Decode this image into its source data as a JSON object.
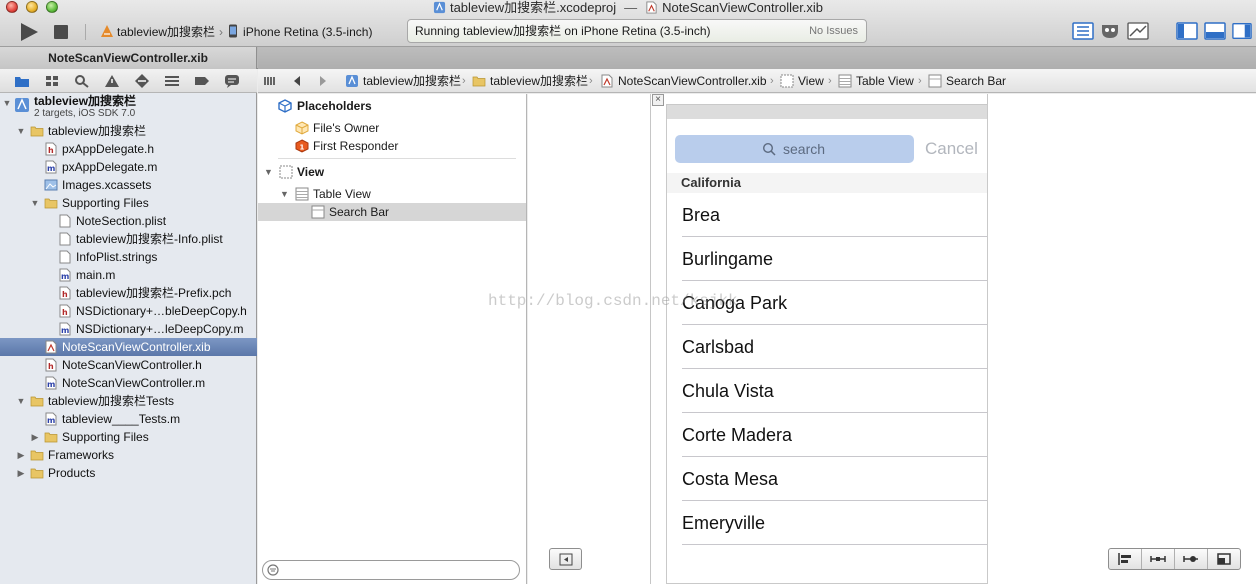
{
  "window": {
    "project_file": "tableview加搜索栏.xcodeproj",
    "separator": "—",
    "open_file": "NoteScanViewController.xib"
  },
  "toolbar": {
    "scheme": "tableview加搜索栏",
    "destination": "iPhone Retina (3.5-inch)",
    "activity_text": "Running tableview加搜索栏 on iPhone Retina (3.5-inch)",
    "activity_status": "No Issues"
  },
  "tab": {
    "title": "NoteScanViewController.xib"
  },
  "project": {
    "name": "tableview加搜索栏",
    "subtitle": "2 targets, iOS SDK 7.0"
  },
  "nav_items": {
    "group_main": "tableview加搜索栏",
    "app_delegate_h": "pxAppDelegate.h",
    "app_delegate_m": "pxAppDelegate.m",
    "images": "Images.xcassets",
    "supporting_files": "Supporting Files",
    "note_section": "NoteSection.plist",
    "info_plist": "tableview加搜索栏-Info.plist",
    "infoplist_strings": "InfoPlist.strings",
    "main_m": "main.m",
    "prefix_pch": "tableview加搜索栏-Prefix.pch",
    "nsdict_h": "NSDictionary+…bleDeepCopy.h",
    "nsdict_m": "NSDictionary+…leDeepCopy.m",
    "xib": "NoteScanViewController.xib",
    "vc_h": "NoteScanViewController.h",
    "vc_m": "NoteScanViewController.m",
    "tests_group": "tableview加搜索栏Tests",
    "tests_m": "tableview____Tests.m",
    "tests_supporting": "Supporting Files",
    "frameworks": "Frameworks",
    "products": "Products"
  },
  "jumpbar": {
    "project": "tableview加搜索栏",
    "group": "tableview加搜索栏",
    "file": "NoteScanViewController.xib",
    "view": "View",
    "table_view": "Table View",
    "search_bar": "Search Bar"
  },
  "outline": {
    "placeholders": "Placeholders",
    "files_owner": "File's Owner",
    "first_responder": "First Responder",
    "view": "View",
    "table_view": "Table View",
    "search_bar": "Search Bar"
  },
  "device": {
    "search_placeholder": "search",
    "cancel_label": "Cancel",
    "section_header": "California",
    "cities": [
      "Brea",
      "Burlingame",
      "Canoga Park",
      "Carlsbad",
      "Chula Vista",
      "Corte Madera",
      "Costa Mesa",
      "Emeryville"
    ]
  },
  "watermark": "http://blog.csdn.net/ksjkk",
  "colors": {
    "selection": "#5b77a9",
    "search_field": "#b9cdec",
    "cancel_text": "#b2b6bd",
    "toolbar_blue": "#2f6fc6"
  }
}
